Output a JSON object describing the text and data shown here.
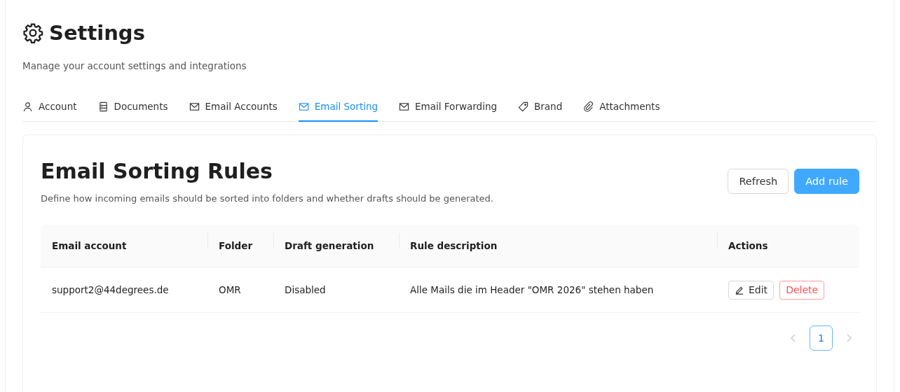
{
  "header": {
    "title": "Settings",
    "subtitle": "Manage your account settings and integrations"
  },
  "tabs": [
    {
      "label": "Account",
      "selected": false
    },
    {
      "label": "Documents",
      "selected": false
    },
    {
      "label": "Email Accounts",
      "selected": false
    },
    {
      "label": "Email Sorting",
      "selected": true
    },
    {
      "label": "Email Forwarding",
      "selected": false
    },
    {
      "label": "Brand",
      "selected": false
    },
    {
      "label": "Attachments",
      "selected": false
    }
  ],
  "card": {
    "title": "Email Sorting Rules",
    "description": "Define how incoming emails should be sorted into folders and whether drafts should be generated.",
    "buttons": [
      {
        "label": "Refresh",
        "kind": "default"
      },
      {
        "label": "Add rule",
        "kind": "primary"
      }
    ]
  },
  "table": {
    "columns": [
      "Email account",
      "Folder",
      "Draft generation",
      "Rule description",
      "Actions"
    ],
    "rows": [
      {
        "cells": [
          "support2@44degrees.de",
          "OMR",
          "Disabled",
          "Alle Mails die im Header \"OMR 2026\" stehen haben"
        ],
        "actions": [
          {
            "label": "Edit",
            "kind": "edit"
          },
          {
            "label": "Delete",
            "kind": "danger"
          }
        ]
      }
    ]
  },
  "pagination": {
    "prev_disabled": true,
    "next_disabled": true,
    "pages": [
      {
        "label": "1",
        "selected": true
      }
    ]
  }
}
